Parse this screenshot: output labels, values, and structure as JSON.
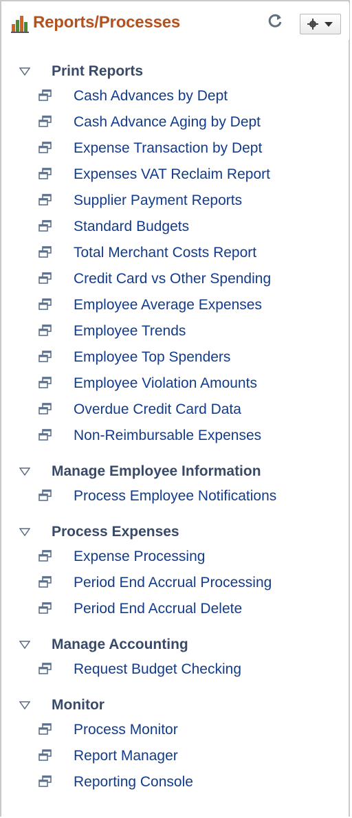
{
  "header": {
    "title": "Reports/Processes",
    "icon": "bar-chart-icon",
    "refresh_icon": "refresh-icon",
    "menu_icon": "gear-icon",
    "accent_color": "#b2521f"
  },
  "groups": [
    {
      "title": "Print Reports",
      "items": [
        "Cash Advances by Dept",
        "Cash Advance Aging by Dept",
        "Expense Transaction by Dept",
        "Expenses VAT Reclaim Report",
        "Supplier Payment Reports",
        "Standard Budgets",
        "Total Merchant Costs Report",
        "Credit Card vs Other Spending",
        "Employee Average Expenses",
        "Employee Trends",
        "Employee Top Spenders",
        "Employee Violation Amounts",
        "Overdue Credit Card Data",
        "Non-Reimbursable Expenses"
      ]
    },
    {
      "title": "Manage Employee Information",
      "items": [
        "Process Employee Notifications"
      ]
    },
    {
      "title": "Process Expenses",
      "items": [
        "Expense Processing",
        "Period End Accrual Processing",
        "Period End Accrual Delete"
      ]
    },
    {
      "title": "Manage Accounting",
      "items": [
        "Request Budget Checking"
      ]
    },
    {
      "title": "Monitor",
      "items": [
        "Process Monitor",
        "Report Manager",
        "Reporting Console"
      ]
    }
  ]
}
